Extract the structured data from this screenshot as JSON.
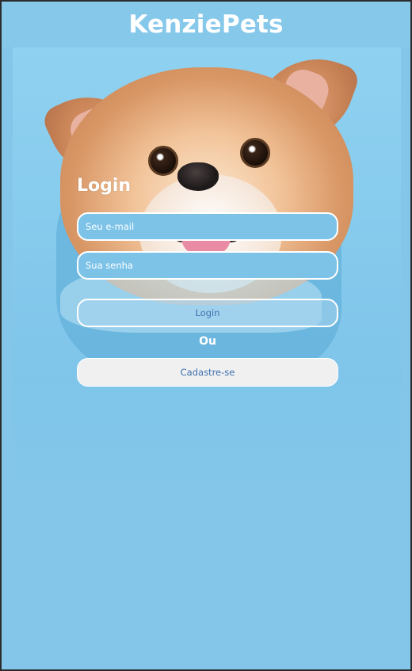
{
  "header": {
    "brand": "KenziePets"
  },
  "hero": {
    "image": "pomeranian-dog-photo"
  },
  "login": {
    "title": "Login",
    "email_placeholder": "Seu e-mail",
    "password_placeholder": "Sua senha",
    "login_button": "Login",
    "separator": "Ou",
    "signup_button": "Cadastre-se"
  },
  "colors": {
    "background": "#84c6e9",
    "button_text": "#3e6fae",
    "signup_background": "#f0f0f0"
  }
}
